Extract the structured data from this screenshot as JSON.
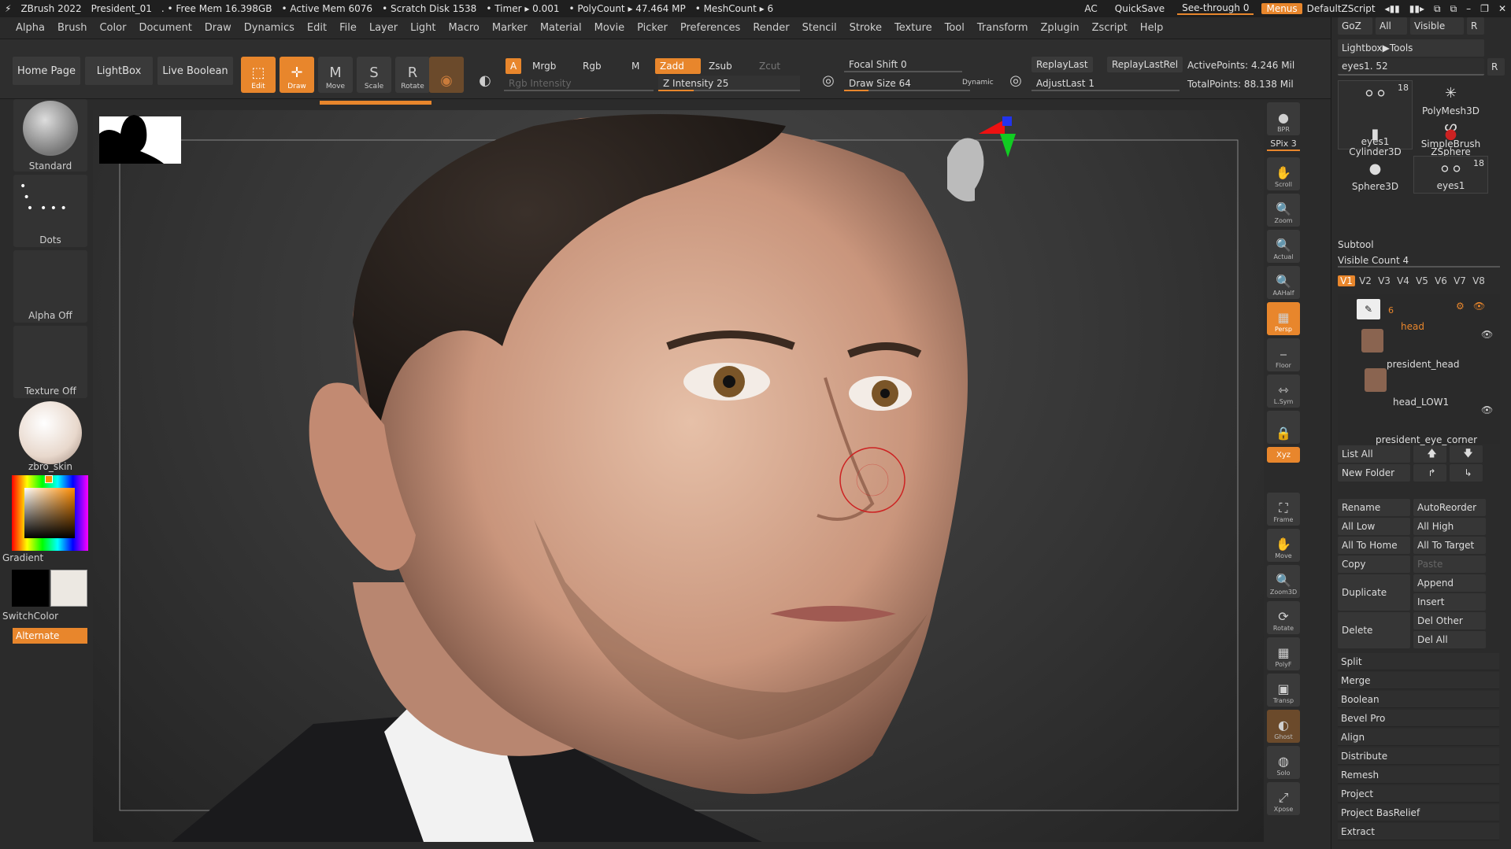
{
  "titlebar": {
    "app": "ZBrush 2022",
    "project": "President_01",
    "free_mem": ". • Free Mem 16.398GB",
    "active_mem": "• Active Mem 6076",
    "scratch": "• Scratch Disk 1538",
    "timer": "• Timer ▸ 0.001",
    "polycount": "• PolyCount ▸ 47.464 MP",
    "meshcount": "• MeshCount ▸ 6",
    "ac": "AC",
    "quicksave": "QuickSave",
    "seethrough": "See-through  0",
    "menus": "Menus",
    "script": "DefaultZScript"
  },
  "menubar": [
    "Alpha",
    "Brush",
    "Color",
    "Document",
    "Draw",
    "Dynamics",
    "Edit",
    "File",
    "Layer",
    "Light",
    "Macro",
    "Marker",
    "Material",
    "Movie",
    "Picker",
    "Preferences",
    "Render",
    "Stencil",
    "Stroke",
    "Texture",
    "Tool",
    "Transform",
    "Zplugin",
    "Zscript",
    "Help"
  ],
  "shelf": {
    "home_page": "Home Page",
    "lightbox": "LightBox",
    "live_boolean": "Live Boolean",
    "tools": [
      {
        "label": "Edit",
        "active": true
      },
      {
        "label": "Draw",
        "active": true
      },
      {
        "label": "Move",
        "active": false
      },
      {
        "label": "Scale",
        "active": false
      },
      {
        "label": "Rotate",
        "active": false
      }
    ],
    "a": "A",
    "mrgb": "Mrgb",
    "rgb": "Rgb",
    "m": "M",
    "zadd": "Zadd",
    "zsub": "Zsub",
    "zcut": "Zcut",
    "rgb_intensity": "Rgb Intensity",
    "z_intensity": "Z Intensity 25",
    "z_intensity_value": 25,
    "focal_shift": "Focal Shift 0",
    "draw_size": "Draw Size 64",
    "draw_size_value": 64,
    "dynamic": "Dynamic",
    "replay_last": "ReplayLast",
    "replay_last_rel": "ReplayLastRel",
    "adjust_last": "AdjustLast 1",
    "active_points": "ActivePoints: 4.246 Mil",
    "total_points": "TotalPoints: 88.138 Mil"
  },
  "leftpanel": {
    "brush": "Standard",
    "stroke": "Dots",
    "alpha": "Alpha Off",
    "texture": "Texture Off",
    "material": "zbro_skin",
    "gradient": "Gradient",
    "switchcolor": "SwitchColor",
    "alternate": "Alternate"
  },
  "righttools": [
    {
      "label": "BPR",
      "icon": "render-sphere-icon"
    },
    {
      "label": "SPix 3",
      "icon": ""
    },
    {
      "label": "Scroll",
      "icon": "hand-icon"
    },
    {
      "label": "Zoom",
      "icon": "magnifier-icon"
    },
    {
      "label": "Actual",
      "icon": "magnifier-icon"
    },
    {
      "label": "AAHalf",
      "icon": "magnifier-icon"
    },
    {
      "label": "Persp",
      "icon": "grid-icon"
    },
    {
      "label": "Floor",
      "icon": "floor-icon"
    },
    {
      "label": "L.Sym",
      "icon": "arrows-icon"
    },
    {
      "label": "",
      "icon": "lock-icon"
    },
    {
      "label": "Xyz",
      "icon": ""
    },
    {
      "label": "Frame",
      "icon": "frame-icon"
    },
    {
      "label": "Move",
      "icon": "hand-icon"
    },
    {
      "label": "Zoom3D",
      "icon": "magnifier-icon"
    },
    {
      "label": "Rotate",
      "icon": "rotate-icon"
    },
    {
      "label": "PolyF",
      "icon": "polyframe-icon"
    },
    {
      "label": "Transp",
      "icon": "transp-icon"
    },
    {
      "label": "Ghost",
      "icon": "ghost-icon"
    },
    {
      "label": "Solo",
      "icon": "solo-icon"
    },
    {
      "label": "Xpose",
      "icon": "xpose-icon"
    }
  ],
  "rightpanel": {
    "goz": "GoZ",
    "all": "All",
    "visible": "Visible",
    "r": "R",
    "lightbox_tools": "Lightbox▶Tools",
    "eyes_slider": "eyes1. 52",
    "thumbs": [
      {
        "label": "eyes1",
        "count": "18"
      },
      {
        "label": "PolyMesh3D",
        "count": ""
      },
      {
        "label": "SimpleBrush",
        "count": ""
      },
      {
        "label": "Cylinder3D",
        "count": ""
      },
      {
        "label": "ZSphere",
        "count": ""
      },
      {
        "label": "Sphere3D",
        "count": ""
      },
      {
        "label": "eyes1",
        "count": "18"
      }
    ],
    "subtool_title": "Subtool",
    "visible_count": "Visible Count 4",
    "vtabs": [
      "V1",
      "V2",
      "V3",
      "V4",
      "V5",
      "V6",
      "V7",
      "V8"
    ],
    "folder_count": "6",
    "subtools": [
      "head",
      "president_head",
      "head_LOW1",
      "president_eye_corner"
    ],
    "list_all": "List All",
    "new_folder": "New Folder",
    "rename": "Rename",
    "autoreorder": "AutoReorder",
    "all_low": "All Low",
    "all_high": "All High",
    "all_to_home": "All To Home",
    "all_to_target": "All To Target",
    "copy": "Copy",
    "paste": "Paste",
    "duplicate": "Duplicate",
    "append": "Append",
    "insert": "Insert",
    "delete": "Delete",
    "del_other": "Del Other",
    "del_all": "Del All",
    "actions": [
      "Split",
      "Merge",
      "Boolean",
      "Bevel Pro",
      "Align",
      "Distribute",
      "Remesh",
      "Project",
      "Project BasRelief",
      "Extract"
    ]
  },
  "colors": {
    "accent": "#e8862c",
    "panel": "#2b2b2b",
    "button": "#3a3a3a"
  }
}
